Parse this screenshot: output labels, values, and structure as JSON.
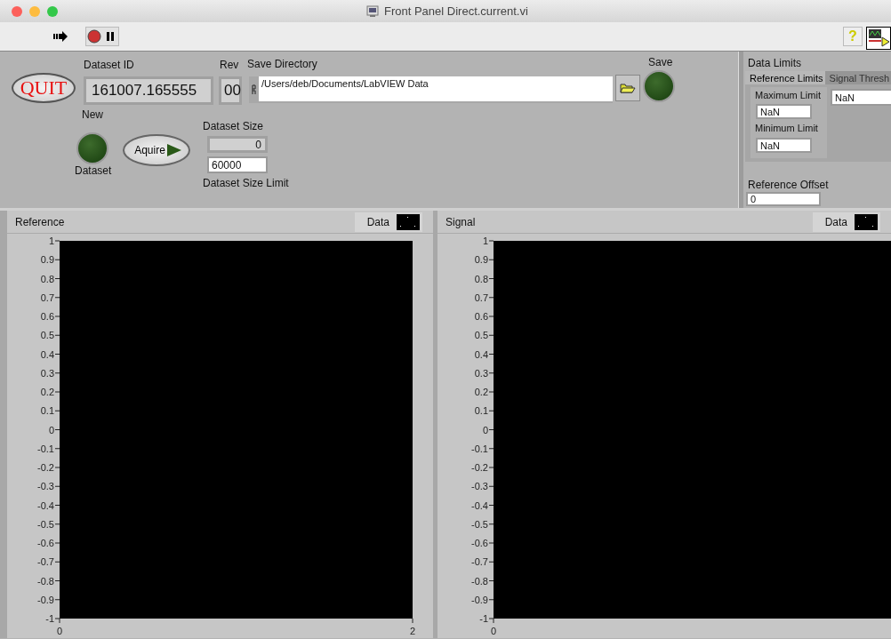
{
  "window": {
    "title": "Front Panel Direct.current.vi"
  },
  "toolbar": {
    "help_button": "?"
  },
  "panel": {
    "quit_button": "QUIT",
    "dataset_id": {
      "label": "Dataset ID",
      "value": "161007.165555"
    },
    "rev": {
      "label": "Rev",
      "value": "00"
    },
    "save_directory": {
      "label": "Save Directory",
      "value": "/Users/deb/Documents/LabVIEW Data"
    },
    "save": {
      "label": "Save",
      "on": false
    },
    "new_dataset": {
      "label_top": "New",
      "label_bottom": "Dataset",
      "on": false
    },
    "acquire_button": "Aquire",
    "dataset_size": {
      "label": "Dataset Size",
      "value": "0"
    },
    "dataset_size_limit": {
      "label": "Dataset Size Limit",
      "value": "60000"
    },
    "data_limits": {
      "title": "Data Limits",
      "tabs": [
        {
          "label": "Reference Limits",
          "selected": true
        },
        {
          "label": "Signal Thresh",
          "selected": false
        }
      ],
      "maximum_limit": {
        "label": "Maximum Limit",
        "value": "NaN"
      },
      "minimum_limit": {
        "label": "Minimum Limit",
        "value": "NaN"
      },
      "signal_threshold_value": "NaN"
    },
    "reference_offset": {
      "label": "Reference Offset",
      "value": "0"
    }
  },
  "graphs": [
    {
      "legend": "Data",
      "chart_data": {
        "type": "line",
        "title": "Reference",
        "xlim": [
          0,
          2
        ],
        "ylim": [
          -1,
          1
        ],
        "xticks": [
          0,
          2
        ],
        "yticks": [
          1,
          0.9,
          0.8,
          0.7,
          0.6,
          0.5,
          0.4,
          0.3,
          0.2,
          0.1,
          0,
          -0.1,
          -0.2,
          -0.3,
          -0.4,
          -0.5,
          -0.6,
          -0.7,
          -0.8,
          -0.9,
          -1
        ]
      }
    },
    {
      "title": "Signal",
      "legend": "Data",
      "y_tick_labels": [
        "1",
        "0.9",
        "0.8",
        "0.7",
        "0.6",
        "0.5",
        "0.4",
        "0.3",
        "0.2",
        "0.1",
        "0",
        "-0.1",
        "-0.2",
        "-0.3",
        "-0.4",
        "-0.5",
        "-0.6",
        "-0.7",
        "-0.8",
        "-0.9",
        "-1"
      ],
      "x_tick_labels": [
        "0"
      ]
    }
  ]
}
